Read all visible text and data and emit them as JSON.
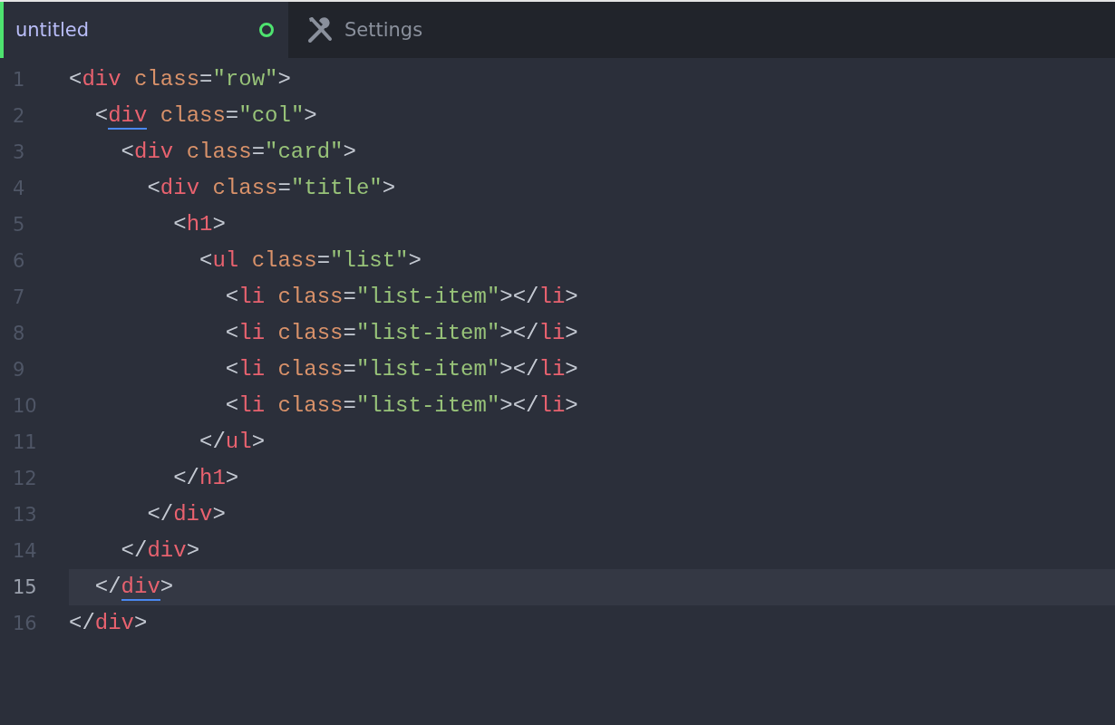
{
  "tabs": [
    {
      "kind": "file",
      "label": "untitled",
      "selected": true,
      "modified": true
    },
    {
      "kind": "settings",
      "label": "Settings",
      "selected": false,
      "modified": false
    }
  ],
  "lines": [
    {
      "number": "1",
      "current": false,
      "tokens": [
        {
          "kind": "punct",
          "text": "<"
        },
        {
          "kind": "tag",
          "text": "div"
        },
        {
          "kind": "attr",
          "text": " class"
        },
        {
          "kind": "punct",
          "text": "="
        },
        {
          "kind": "string",
          "text": "\"row\""
        },
        {
          "kind": "punct",
          "text": ">"
        }
      ]
    },
    {
      "number": "2",
      "current": false,
      "tokens": [
        {
          "kind": "punct",
          "text": "  <"
        },
        {
          "kind": "tag",
          "text": "div",
          "matched": true
        },
        {
          "kind": "attr",
          "text": " class"
        },
        {
          "kind": "punct",
          "text": "="
        },
        {
          "kind": "string",
          "text": "\"col\""
        },
        {
          "kind": "punct",
          "text": ">"
        }
      ]
    },
    {
      "number": "3",
      "current": false,
      "tokens": [
        {
          "kind": "punct",
          "text": "    <"
        },
        {
          "kind": "tag",
          "text": "div"
        },
        {
          "kind": "attr",
          "text": " class"
        },
        {
          "kind": "punct",
          "text": "="
        },
        {
          "kind": "string",
          "text": "\"card\""
        },
        {
          "kind": "punct",
          "text": ">"
        }
      ]
    },
    {
      "number": "4",
      "current": false,
      "tokens": [
        {
          "kind": "punct",
          "text": "      <"
        },
        {
          "kind": "tag",
          "text": "div"
        },
        {
          "kind": "attr",
          "text": " class"
        },
        {
          "kind": "punct",
          "text": "="
        },
        {
          "kind": "string",
          "text": "\"title\""
        },
        {
          "kind": "punct",
          "text": ">"
        }
      ]
    },
    {
      "number": "5",
      "current": false,
      "tokens": [
        {
          "kind": "punct",
          "text": "        <"
        },
        {
          "kind": "tag",
          "text": "h1"
        },
        {
          "kind": "punct",
          "text": ">"
        }
      ]
    },
    {
      "number": "6",
      "current": false,
      "tokens": [
        {
          "kind": "punct",
          "text": "          <"
        },
        {
          "kind": "tag",
          "text": "ul"
        },
        {
          "kind": "attr",
          "text": " class"
        },
        {
          "kind": "punct",
          "text": "="
        },
        {
          "kind": "string",
          "text": "\"list\""
        },
        {
          "kind": "punct",
          "text": ">"
        }
      ]
    },
    {
      "number": "7",
      "current": false,
      "tokens": [
        {
          "kind": "punct",
          "text": "            <"
        },
        {
          "kind": "tag",
          "text": "li"
        },
        {
          "kind": "attr",
          "text": " class"
        },
        {
          "kind": "punct",
          "text": "="
        },
        {
          "kind": "string",
          "text": "\"list-item\""
        },
        {
          "kind": "punct",
          "text": "></"
        },
        {
          "kind": "tag",
          "text": "li"
        },
        {
          "kind": "punct",
          "text": ">"
        }
      ]
    },
    {
      "number": "8",
      "current": false,
      "tokens": [
        {
          "kind": "punct",
          "text": "            <"
        },
        {
          "kind": "tag",
          "text": "li"
        },
        {
          "kind": "attr",
          "text": " class"
        },
        {
          "kind": "punct",
          "text": "="
        },
        {
          "kind": "string",
          "text": "\"list-item\""
        },
        {
          "kind": "punct",
          "text": "></"
        },
        {
          "kind": "tag",
          "text": "li"
        },
        {
          "kind": "punct",
          "text": ">"
        }
      ]
    },
    {
      "number": "9",
      "current": false,
      "tokens": [
        {
          "kind": "punct",
          "text": "            <"
        },
        {
          "kind": "tag",
          "text": "li"
        },
        {
          "kind": "attr",
          "text": " class"
        },
        {
          "kind": "punct",
          "text": "="
        },
        {
          "kind": "string",
          "text": "\"list-item\""
        },
        {
          "kind": "punct",
          "text": "></"
        },
        {
          "kind": "tag",
          "text": "li"
        },
        {
          "kind": "punct",
          "text": ">"
        }
      ]
    },
    {
      "number": "10",
      "current": false,
      "tokens": [
        {
          "kind": "punct",
          "text": "            <"
        },
        {
          "kind": "tag",
          "text": "li"
        },
        {
          "kind": "attr",
          "text": " class"
        },
        {
          "kind": "punct",
          "text": "="
        },
        {
          "kind": "string",
          "text": "\"list-item\""
        },
        {
          "kind": "punct",
          "text": "></"
        },
        {
          "kind": "tag",
          "text": "li"
        },
        {
          "kind": "punct",
          "text": ">"
        }
      ]
    },
    {
      "number": "11",
      "current": false,
      "tokens": [
        {
          "kind": "punct",
          "text": "          </"
        },
        {
          "kind": "tag",
          "text": "ul"
        },
        {
          "kind": "punct",
          "text": ">"
        }
      ]
    },
    {
      "number": "12",
      "current": false,
      "tokens": [
        {
          "kind": "punct",
          "text": "        </"
        },
        {
          "kind": "tag",
          "text": "h1"
        },
        {
          "kind": "punct",
          "text": ">"
        }
      ]
    },
    {
      "number": "13",
      "current": false,
      "tokens": [
        {
          "kind": "punct",
          "text": "      </"
        },
        {
          "kind": "tag",
          "text": "div"
        },
        {
          "kind": "punct",
          "text": ">"
        }
      ]
    },
    {
      "number": "14",
      "current": false,
      "tokens": [
        {
          "kind": "punct",
          "text": "    </"
        },
        {
          "kind": "tag",
          "text": "div"
        },
        {
          "kind": "punct",
          "text": ">"
        }
      ]
    },
    {
      "number": "15",
      "current": true,
      "tokens": [
        {
          "kind": "punct",
          "text": "  </"
        },
        {
          "kind": "tag",
          "text": "div",
          "matched": true
        },
        {
          "kind": "punct",
          "text": ">"
        }
      ]
    },
    {
      "number": "16",
      "current": false,
      "tokens": [
        {
          "kind": "punct",
          "text": "</"
        },
        {
          "kind": "tag",
          "text": "div"
        },
        {
          "kind": "punct",
          "text": ">"
        }
      ]
    }
  ]
}
